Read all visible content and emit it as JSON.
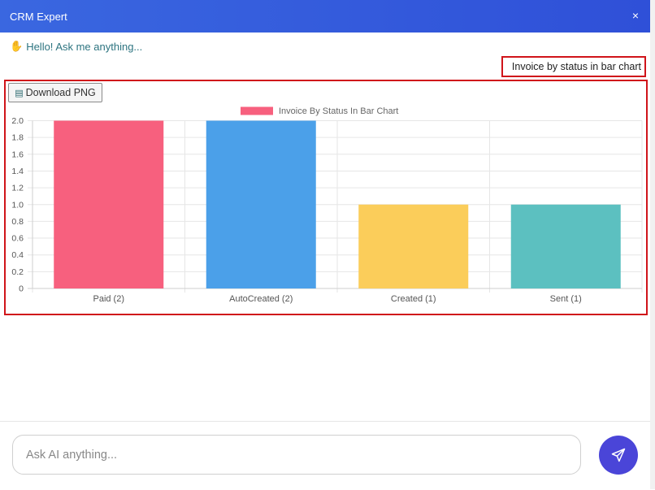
{
  "header": {
    "title": "CRM Expert",
    "close_label": "×"
  },
  "messages": {
    "greeting": "Hello! Ask me anything...",
    "greeting_icon": "waving-hand-icon",
    "user_query": "Invoice by status in bar chart"
  },
  "chart_panel": {
    "download_label": "Download PNG",
    "download_icon": "floppy-disk-icon"
  },
  "chart_data": {
    "type": "bar",
    "categories": [
      "Paid (2)",
      "AutoCreated (2)",
      "Created (1)",
      "Sent (1)"
    ],
    "series": [
      {
        "name": "Invoice By Status In Bar Chart",
        "values": [
          2,
          2,
          1,
          1
        ]
      }
    ],
    "colors": [
      "#f7607e",
      "#4ba0e9",
      "#fbcd5a",
      "#5cc0c0"
    ],
    "legend_color": "#f7607e",
    "ylim": [
      0,
      2.0
    ],
    "yticks": [
      "0",
      "0.2",
      "0.4",
      "0.6",
      "0.8",
      "1.0",
      "1.2",
      "1.4",
      "1.6",
      "1.8",
      "2.0"
    ],
    "grid": true,
    "legend": "top-center"
  },
  "composer": {
    "placeholder": "Ask AI anything...",
    "send_icon": "send-icon"
  }
}
